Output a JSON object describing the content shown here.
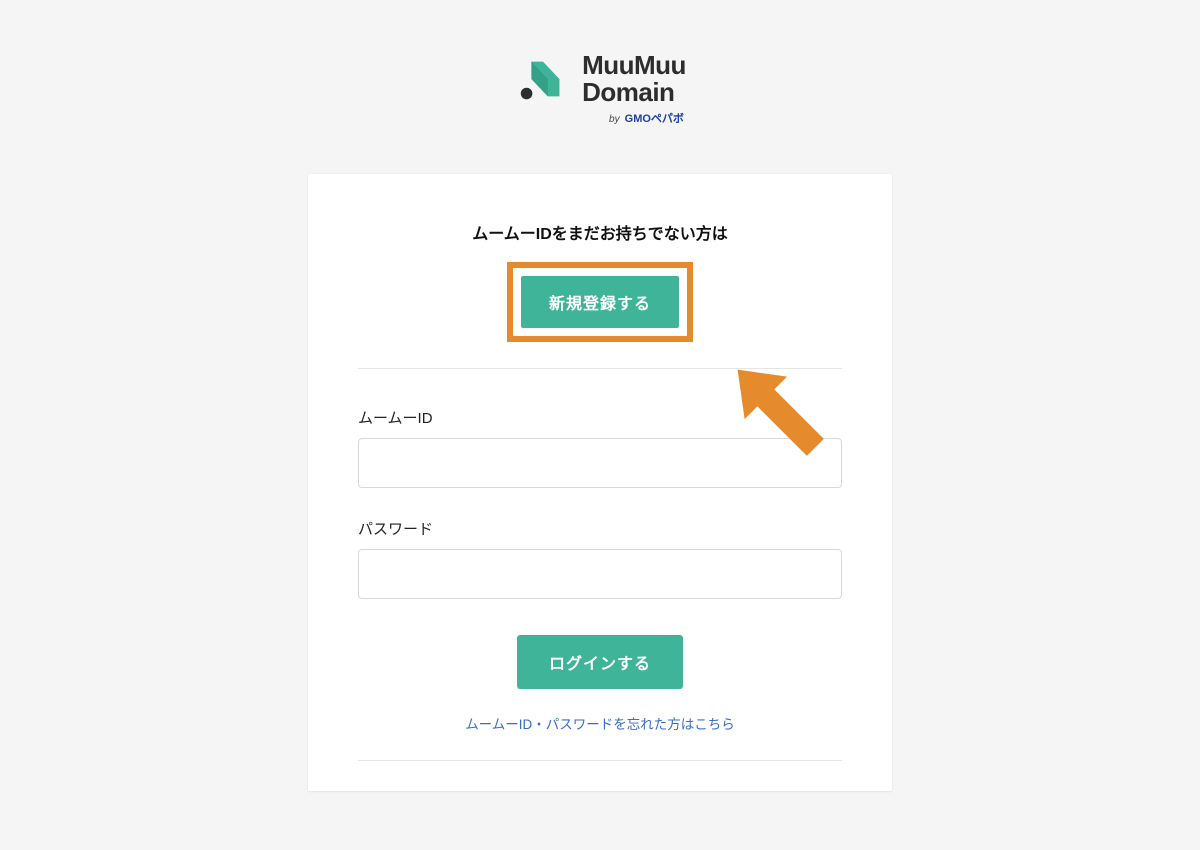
{
  "brand": {
    "name_line1": "MuuMuu",
    "name_line2": "Domain",
    "byline_by": "by",
    "byline_gmo": "GMO",
    "byline_pepabo": "ペパボ",
    "accent_color": "#3fb498"
  },
  "signup": {
    "prompt": "ムームーIDをまだお持ちでない方は",
    "button_label": "新規登録する"
  },
  "login": {
    "id_label": "ムームーID",
    "password_label": "パスワード",
    "button_label": "ログインする",
    "forgot_link": "ムームーID・パスワードを忘れた方はこちら"
  },
  "annotation": {
    "highlight_color": "#e68a2e"
  }
}
